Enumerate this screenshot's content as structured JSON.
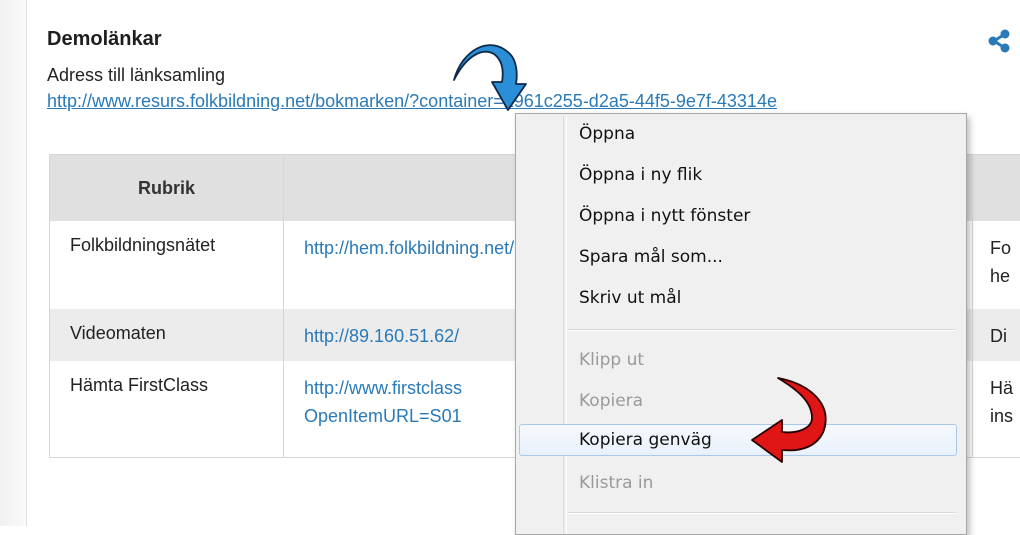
{
  "page": {
    "title": "Demolänkar",
    "subtitle": "Adress till länksamling",
    "link": "http://www.resurs.folkbildning.net/bokmarken/?container=1961c255-d2a5-44f5-9e7f-43314e",
    "share_icon": "share-icon"
  },
  "table": {
    "headers": [
      "Rubrik",
      "",
      ""
    ],
    "rows": [
      {
        "title": "Folkbildningsnätet",
        "url_lines": [
          "http://hem.folkbildning.net/"
        ],
        "desc_lines": [
          "Fo",
          "he"
        ]
      },
      {
        "title": "Videomaten",
        "url_lines": [
          "http://89.160.51.62/"
        ],
        "desc_lines": [
          "Di"
        ]
      },
      {
        "title": "Hämta FirstClass",
        "url_lines": [
          "http://www.firstclass",
          "OpenItemURL=S01"
        ],
        "desc_lines": [
          "Hä",
          "ins"
        ]
      }
    ]
  },
  "context_menu": {
    "items": [
      {
        "label": "Öppna",
        "disabled": false
      },
      {
        "label": "Öppna i ny flik",
        "disabled": false
      },
      {
        "label": "Öppna i nytt fönster",
        "disabled": false
      },
      {
        "label": "Spara mål som...",
        "disabled": false
      },
      {
        "label": "Skriv ut mål",
        "disabled": false
      },
      {
        "label": "Klipp ut",
        "disabled": true
      },
      {
        "label": "Kopiera",
        "disabled": true
      },
      {
        "label": "Kopiera genväg",
        "disabled": false,
        "highlighted": true
      },
      {
        "label": "Klistra in",
        "disabled": true
      }
    ]
  },
  "colors": {
    "link": "#2a7ab9",
    "annotation_arrow_blue": "#2b8fd8",
    "annotation_arrow_red": "#e01515"
  }
}
